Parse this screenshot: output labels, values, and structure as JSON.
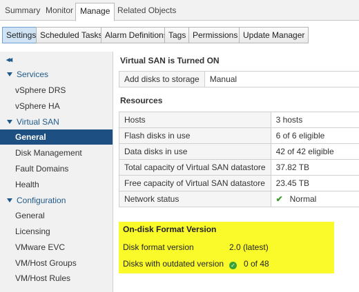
{
  "top_tabs": [
    "Summary",
    "Monitor",
    "Manage",
    "Related Objects"
  ],
  "sub_tabs": [
    "Settings",
    "Scheduled Tasks",
    "Alarm Definitions",
    "Tags",
    "Permissions",
    "Update Manager"
  ],
  "sidebar": {
    "collapse_glyph": "◂◂",
    "services": {
      "label": "Services",
      "items": [
        "vSphere DRS",
        "vSphere HA"
      ]
    },
    "vsan": {
      "label": "Virtual SAN",
      "items": [
        "General",
        "Disk Management",
        "Fault Domains",
        "Health"
      ],
      "selected": "General"
    },
    "configuration": {
      "label": "Configuration",
      "items": [
        "General",
        "Licensing",
        "VMware EVC",
        "VM/Host Groups",
        "VM/Host Rules"
      ]
    }
  },
  "main": {
    "status_title": "Virtual SAN is Turned ON",
    "add_disks": {
      "label": "Add disks to storage",
      "value": "Manual"
    },
    "resources_title": "Resources",
    "resources": [
      {
        "label": "Hosts",
        "value": "3 hosts"
      },
      {
        "label": "Flash disks in use",
        "value": "6 of 6 eligible"
      },
      {
        "label": "Data disks in use",
        "value": "42 of 42 eligible"
      },
      {
        "label": "Total capacity of Virtual SAN datastore",
        "value": "37.82 TB"
      },
      {
        "label": "Free capacity of Virtual SAN datastore",
        "value": "23.45 TB"
      },
      {
        "label": "Network status",
        "value": "Normal"
      }
    ],
    "ondisk": {
      "title": "On-disk Format Version",
      "format_label": "Disk format version",
      "format_value": "2.0 (latest)",
      "outdated_label": "Disks with outdated version",
      "outdated_value": "0 of 48"
    }
  },
  "colors": {
    "selected_nav": "#1e4f82",
    "highlight": "#fafa2a",
    "ok_green": "#3aa235"
  }
}
